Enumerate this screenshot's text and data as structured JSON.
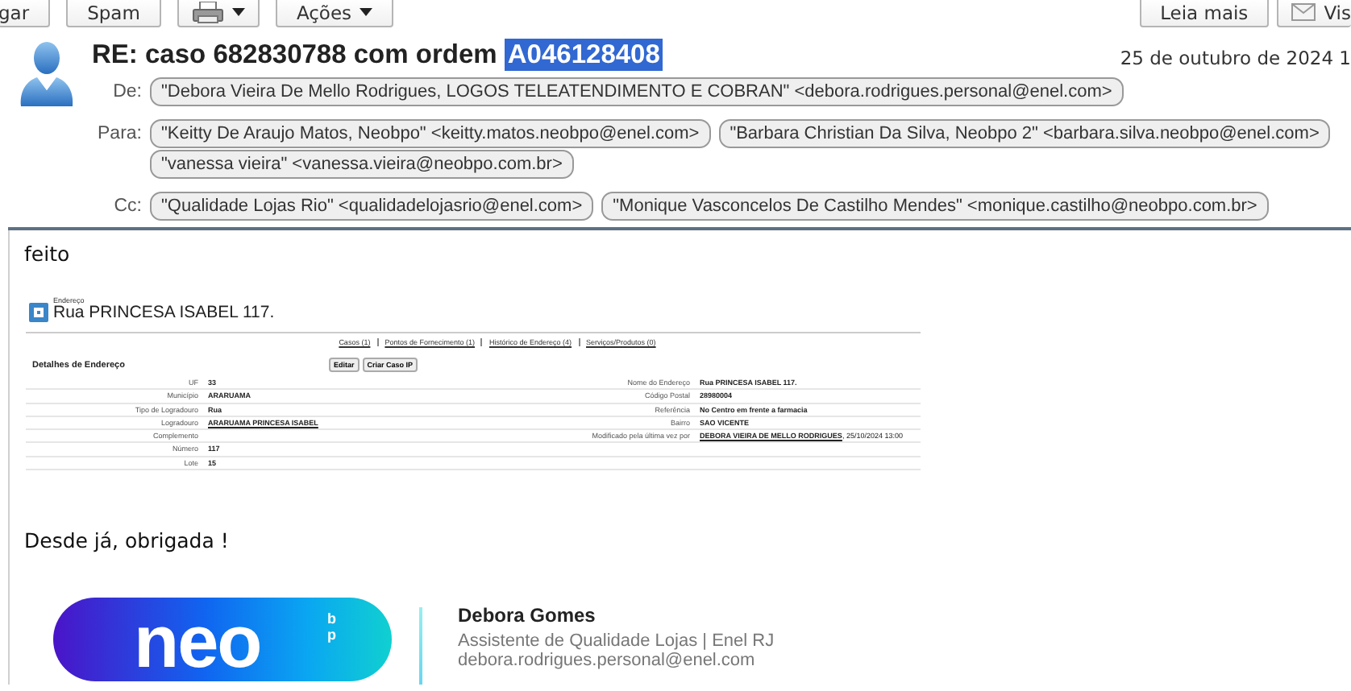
{
  "toolbar": {
    "left_buttons": [
      {
        "kind": "text",
        "label": "gar"
      },
      {
        "kind": "text",
        "label": "Spam"
      },
      {
        "kind": "print"
      },
      {
        "kind": "menu",
        "label": "Ações"
      }
    ],
    "right_buttons": [
      {
        "kind": "text",
        "label": "Leia mais"
      },
      {
        "kind": "mail",
        "label": "Vis"
      }
    ]
  },
  "message": {
    "subject": [
      {
        "text": "RE: caso 682830788 com ordem ",
        "selected": false
      },
      {
        "text": "A046128408",
        "selected": true
      }
    ],
    "date": "25 de outubro de 2024 1",
    "fields": [
      {
        "label": "De:",
        "recipients": [
          "\"Debora Vieira De Mello Rodrigues, LOGOS TELEATENDIMENTO E COBRAN\" <debora.rodrigues.personal@enel.com>"
        ]
      },
      {
        "label": "Para:",
        "recipients": [
          "\"Keitty De Araujo Matos, Neobpo\" <keitty.matos.neobpo@enel.com>",
          "\"Barbara Christian Da Silva, Neobpo 2\" <barbara.silva.neobpo@enel.com>",
          "\"vanessa vieira\" <vanessa.vieira@neobpo.com.br>"
        ]
      },
      {
        "label": "Cc:",
        "recipients": [
          "\"Qualidade Lojas Rio\" <qualidadelojasrio@enel.com>",
          "\"Monique Vasconcelos De Castilho Mendes\" <monique.castilho@neobpo.com.br>"
        ]
      }
    ]
  },
  "body": {
    "greeting": "feito",
    "screenshot": {
      "caption": "Endereço",
      "title": "Rua PRINCESA ISABEL 117.",
      "links": [
        "Casos (1)",
        "Pontos de Fornecimento (1)",
        "Histórico de Endereço (4)",
        "Serviços/Produtos (0)"
      ],
      "section": "Detalhes de Endereço",
      "buttons": [
        "Editar",
        "Criar Caso IP"
      ],
      "left_fields": [
        {
          "label": "UF",
          "value": "33",
          "link": false
        },
        {
          "label": "Município",
          "value": "ARARUAMA",
          "link": false
        },
        {
          "label": "Tipo de Logradouro",
          "value": "Rua",
          "link": false
        },
        {
          "label": "Logradouro",
          "value": "ARARUAMA PRINCESA ISABEL",
          "link": true
        },
        {
          "label": "Complemento"
        },
        {
          "label": "Número",
          "value": "117",
          "link": false
        },
        {
          "label": "Lote",
          "value": "15",
          "link": false
        }
      ],
      "right_fields": [
        {
          "label": "Nome do Endereço",
          "value": "Rua PRINCESA ISABEL 117.",
          "link": false
        },
        {
          "label": "Código Postal",
          "value": "28980004",
          "link": false
        },
        {
          "label": "Referência",
          "value": "No Centro em frente a farmacia",
          "link": false
        },
        {
          "label": "Bairro",
          "value": "SAO VICENTE",
          "link": false
        },
        {
          "label": "Modificado pela última vez por",
          "value": "DEBORA VIEIRA DE MELLO RODRIGUES",
          "link": true,
          "suffix": ", 25/10/2024 13:00"
        }
      ]
    },
    "closing": "Desde já, obrigada !",
    "signature": {
      "logo": "neo",
      "logo_small": "bp",
      "name": "Debora Gomes",
      "role": "Assistente de Qualidade Lojas | Enel RJ",
      "email": "debora.rodrigues.personal@enel.com"
    }
  }
}
